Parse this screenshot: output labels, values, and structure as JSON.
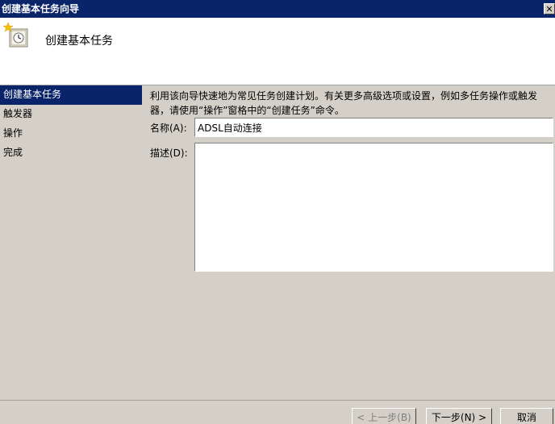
{
  "window": {
    "title": "创建基本任务向导",
    "close_glyph": "✕"
  },
  "header": {
    "icon": "task-clock-icon",
    "title": "创建基本任务"
  },
  "steps": [
    {
      "label": "创建基本任务",
      "active": true
    },
    {
      "label": "触发器",
      "active": false
    },
    {
      "label": "操作",
      "active": false
    },
    {
      "label": "完成",
      "active": false
    }
  ],
  "content": {
    "description": "利用该向导快速地为常见任务创建计划。有关更多高级选项或设置，例如多任务操作或触发器，请使用“操作”窗格中的“创建任务”命令。",
    "name_label": "名称(A):",
    "name_value": "ADSL自动连接",
    "desc_label": "描述(D):",
    "desc_value": ""
  },
  "footer": {
    "back_label": "< 上一步(B)",
    "next_label": "下一步(N) >",
    "cancel_label": "取消"
  },
  "colors": {
    "titlebar": "#0a246a",
    "face": "#d4d0c8",
    "active_step": "#0a246a"
  }
}
